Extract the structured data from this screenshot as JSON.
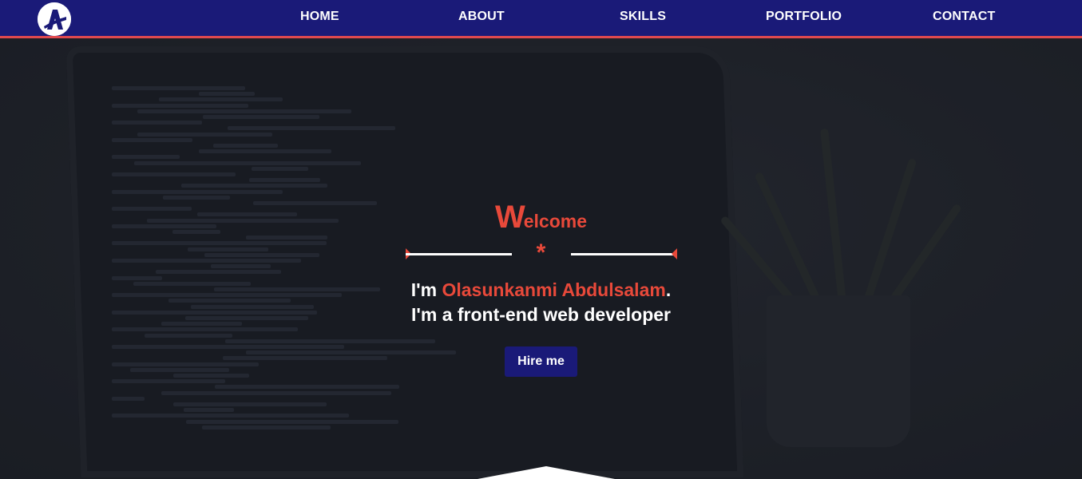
{
  "nav": {
    "logo_letter": "A",
    "links": [
      "HOME",
      "ABOUT",
      "SKILLS",
      "PORTFOLIO",
      "CONTACT"
    ]
  },
  "hero": {
    "welcome_initial": "W",
    "welcome_rest": "elcome",
    "divider_symbol": "*",
    "intro_prefix": "I'm ",
    "name": "Olasunkanmi Abdulsalam",
    "intro_suffix": ".",
    "role_line": "I'm a front-end web developer",
    "hire_label": "Hire me"
  },
  "colors": {
    "nav_bg": "#1a1a78",
    "accent": "#e8493a",
    "nav_border": "#e0494f",
    "text": "#ffffff"
  },
  "icons": {
    "logo": "letter-a-logo-icon",
    "divider": "asterisk-icon"
  }
}
